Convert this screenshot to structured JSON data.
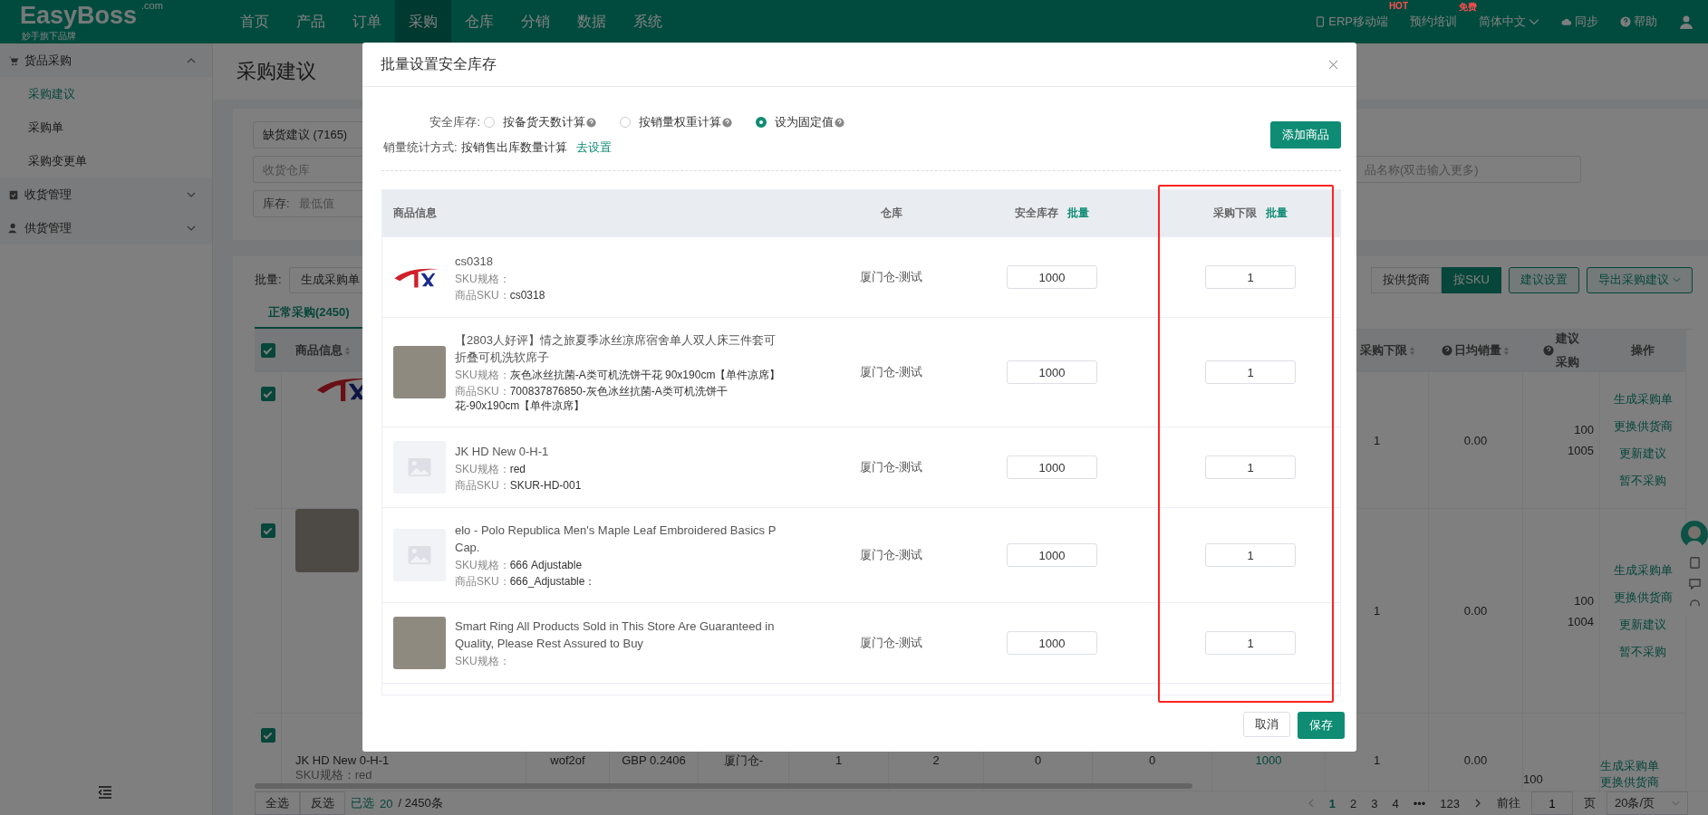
{
  "topbar": {
    "logo": "EasyBoss",
    "logo_domain": ".com",
    "logo_tagline": "妙手旗下品牌",
    "nav": [
      {
        "label": "首页",
        "selected": false
      },
      {
        "label": "产品",
        "selected": false
      },
      {
        "label": "订单",
        "selected": false
      },
      {
        "label": "采购",
        "selected": true
      },
      {
        "label": "仓库",
        "selected": false
      },
      {
        "label": "分销",
        "selected": false
      },
      {
        "label": "数据",
        "selected": false
      },
      {
        "label": "系统",
        "selected": false
      }
    ],
    "tools": [
      {
        "kind": "phone",
        "label": "ERP移动端",
        "badge": "HOT"
      },
      {
        "kind": "plain",
        "label": "预约培训",
        "badge": "免费"
      },
      {
        "kind": "language",
        "label": "简体中文"
      },
      {
        "kind": "cloud",
        "label": "同步"
      },
      {
        "kind": "help",
        "label": "帮助"
      },
      {
        "kind": "user"
      }
    ]
  },
  "sidebar": {
    "groups": [
      {
        "label": "货品采购",
        "expanded": true,
        "children": [
          {
            "label": "采购建议",
            "selected": true
          },
          {
            "label": "采购单",
            "selected": false
          },
          {
            "label": "采购变更单",
            "selected": false
          }
        ]
      },
      {
        "label": "收货管理",
        "expanded": false
      },
      {
        "label": "供货管理",
        "expanded": false
      }
    ]
  },
  "page": {
    "title": "采购建议",
    "filters": {
      "suggestion": "缺货建议 (7165)",
      "warehouse_placeholder": "收货仓库",
      "stock_label": "库存:",
      "stock_placeholder": "最低值",
      "search_placeholder": "品名称(双击输入更多)"
    },
    "toolbar": {
      "batch_label": "批量:",
      "batch_action": "生成采购单",
      "views": [
        {
          "label": "按供货商",
          "selected": false
        },
        {
          "label": "按SKU",
          "selected": true
        }
      ],
      "settings": "建议设置",
      "export": "导出采购建议"
    },
    "tabs": [
      {
        "label": "正常采购(2450)",
        "selected": true
      }
    ],
    "table": {
      "header_checked": true,
      "columns": {
        "product": "商品信息",
        "min": "采购下限",
        "daily": "日均销量",
        "suggest": [
          "建议",
          "采购"
        ],
        "actions": "操作"
      },
      "rows": [
        {
          "checked": true,
          "cells": [],
          "min": "1",
          "daily": "0.00",
          "suggest": [
            "100",
            "1005"
          ],
          "actions": [
            "生成采购单",
            "更换供货商",
            "更新建议",
            "暂不采购"
          ]
        },
        {
          "checked": true,
          "cells": [],
          "min": "1",
          "daily": "0.00",
          "suggest": [
            "100",
            "1004"
          ],
          "actions": [
            "生成采购单",
            "更换供货商",
            "更新建议",
            "暂不采购"
          ]
        },
        {
          "checked": true,
          "name": "JK HD New 0-H-1",
          "spec": "SKU规格：red",
          "cells": [
            {
              "text": "wof2of",
              "link": false
            },
            {
              "text": "GBP 0.2406",
              "link": false
            },
            {
              "text": "厦门仓-",
              "link": false
            },
            {
              "text": "1",
              "link": false
            },
            {
              "text": "2",
              "link": false
            },
            {
              "text": "0",
              "link": false
            },
            {
              "text": "0",
              "link": false
            },
            {
              "text": "1000",
              "link": true
            }
          ],
          "min": "1",
          "daily": "0.00",
          "suggest": [
            "100"
          ],
          "actions": [
            "生成采购单",
            "更换供货商"
          ]
        }
      ]
    },
    "footer": {
      "select_all": "全选",
      "invert": "反选",
      "selected_label": "已选",
      "selected_count": "20",
      "total": "/ 2450条"
    },
    "pagination": {
      "pages": [
        {
          "label": "1",
          "selected": true
        },
        {
          "label": "2",
          "selected": false
        },
        {
          "label": "3",
          "selected": false
        },
        {
          "label": "4",
          "selected": false
        },
        {
          "label": "•••",
          "selected": false
        },
        {
          "label": "123",
          "selected": false
        }
      ],
      "goto_label": "前往",
      "goto_value": "1",
      "page_label": "页",
      "page_size": "20条/页"
    }
  },
  "modal": {
    "title": "批量设置安全库存",
    "mode_label": "安全库存:",
    "modes": [
      {
        "label": "按备货天数计算",
        "selected": false
      },
      {
        "label": "按销量权重计算",
        "selected": false
      },
      {
        "label": "设为固定值",
        "selected": true
      }
    ],
    "sales_label": "销量统计方式:",
    "sales_value": "按销售出库数量计算",
    "sales_link": "去设置",
    "add_button": "添加商品",
    "columns": {
      "product": "商品信息",
      "warehouse": "仓库",
      "safety": "安全库存",
      "safety_batch": "批量",
      "min": "采购下限",
      "min_batch": "批量"
    },
    "rows": [
      {
        "name": "cs0318",
        "spec_label": "SKU规格：",
        "spec": "",
        "sku_label": "商品SKU：",
        "sku": "cs0318",
        "warehouse": "厦门仓-测试",
        "safety": "1000",
        "min": "1"
      },
      {
        "name": "【2803人好评】情之旅夏季冰丝凉席宿舍单人双人床三件套可折叠可机洗软席子",
        "spec_label": "SKU规格：",
        "spec": "灰色冰丝抗菌-A类可机洗饼干花 90x190cm【单件凉席】",
        "sku_label": "商品SKU：",
        "sku": "700837876850-灰色冰丝抗菌-A类可机洗饼干花-90x190cm【单件凉席】",
        "warehouse": "厦门仓-测试",
        "safety": "1000",
        "min": "1"
      },
      {
        "name": "JK HD New 0-H-1",
        "spec_label": "SKU规格：",
        "spec": "red",
        "sku_label": "商品SKU：",
        "sku": "SKUR-HD-001",
        "warehouse": "厦门仓-测试",
        "safety": "1000",
        "min": "1"
      },
      {
        "name": "elo -  Polo Republica Men's Maple Leaf Embroidered Basics P Cap.",
        "spec_label": "SKU规格：",
        "spec": "666 Adjustable",
        "sku_label": "商品SKU：",
        "sku": "666_Adjustable：",
        "warehouse": "厦门仓-测试",
        "safety": "1000",
        "min": "1"
      },
      {
        "name": "Smart Ring All Products Sold in This Store Are Guaranteed in Quality, Please Rest Assured to Buy",
        "spec_label": "SKU规格：",
        "spec": "",
        "warehouse": "厦门仓-测试",
        "safety": "1000",
        "min": "1"
      }
    ],
    "cancel": "取消",
    "save": "保存"
  }
}
